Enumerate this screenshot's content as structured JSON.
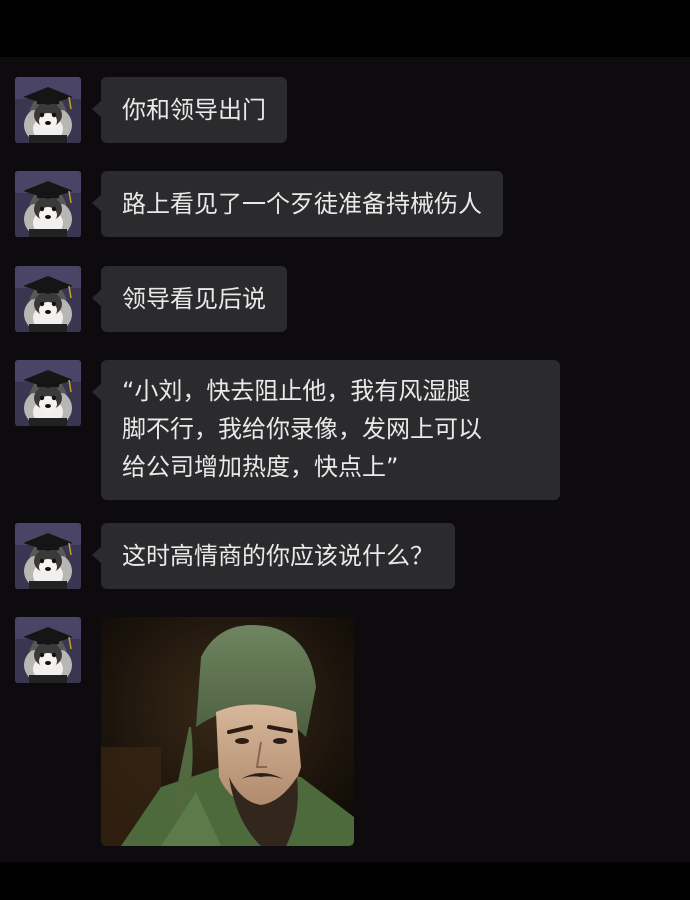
{
  "chat": {
    "messages": [
      {
        "avatar": "husky-graduation-cap-avatar",
        "text": "你和领导出门"
      },
      {
        "avatar": "husky-graduation-cap-avatar",
        "text": "路上看见了一个歹徒准备持械伤人"
      },
      {
        "avatar": "husky-graduation-cap-avatar",
        "text": "领导看见后说"
      },
      {
        "avatar": "husky-graduation-cap-avatar",
        "lines": [
          "“小刘，快去阻止他，我有风湿腿",
          "脚不行，我给你录像，发网上可以",
          "给公司增加热度，快点上”"
        ]
      },
      {
        "avatar": "husky-graduation-cap-avatar",
        "text": "这时高情商的你应该说什么？"
      },
      {
        "avatar": "husky-graduation-cap-avatar",
        "sticker": "guan-yu-stern-face-sticker"
      }
    ]
  },
  "colors": {
    "background": "#0d0b0e",
    "bubble": "#2b2b2d",
    "text": "#e9e9ea"
  }
}
